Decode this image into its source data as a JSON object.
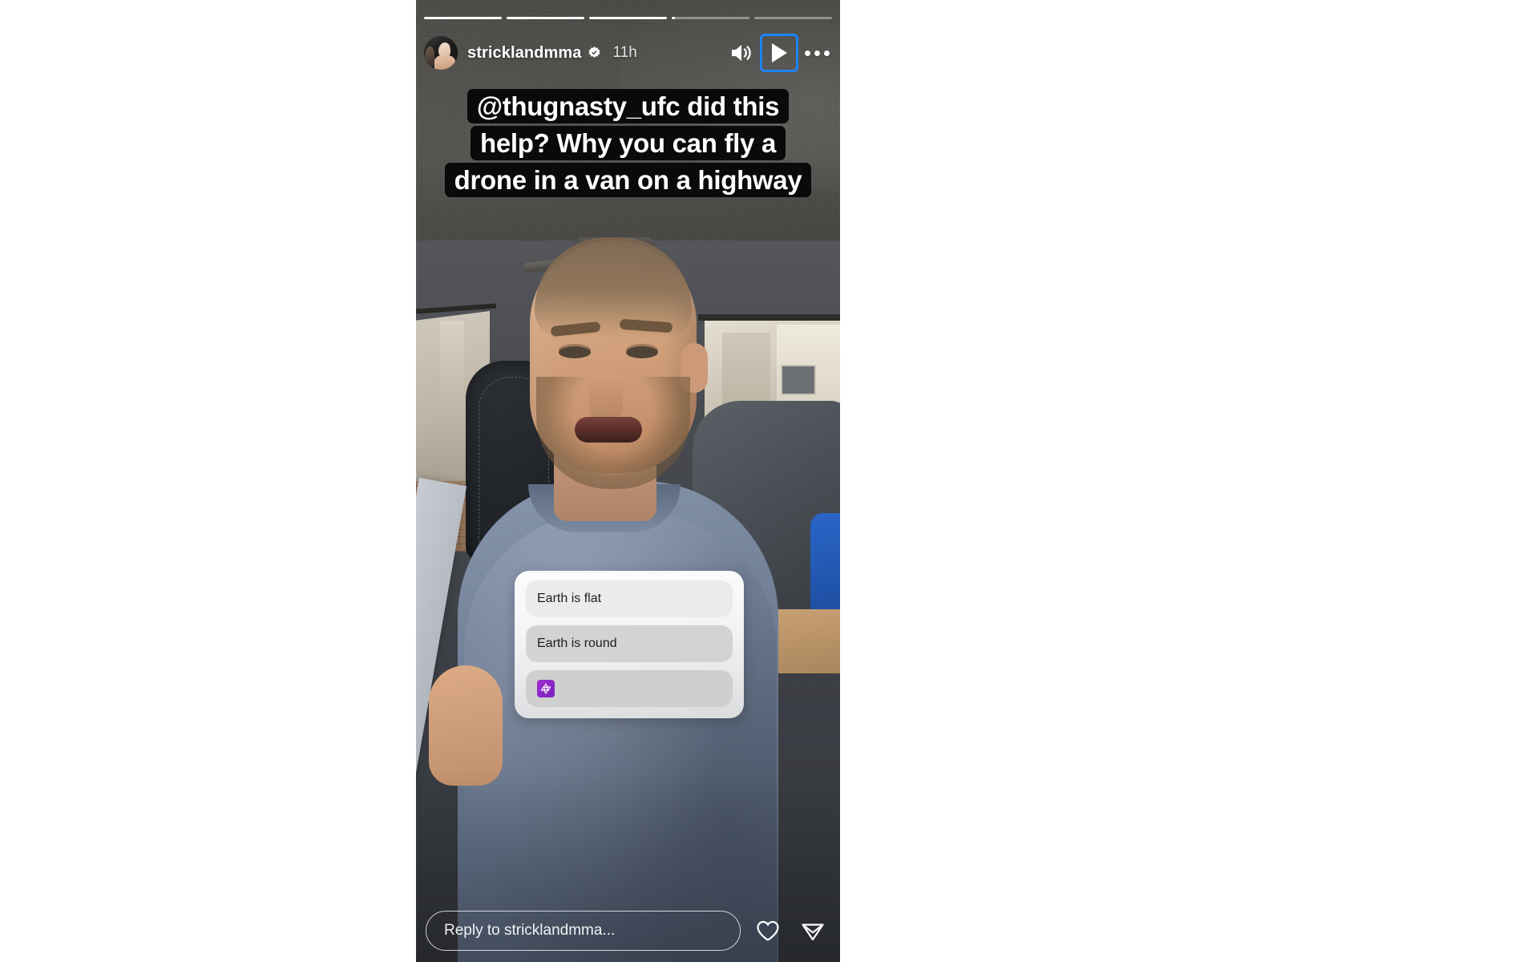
{
  "app": {
    "name": "Instagram Stories",
    "frame_background": "#4b4b4b",
    "accent_focus_color": "#1a84ff"
  },
  "progress": {
    "segment_count": 5,
    "fills_percent": [
      100,
      100,
      100,
      4,
      0
    ]
  },
  "header": {
    "avatar_alt": "stricklandmma profile photo",
    "username": "stricklandmma",
    "verified": true,
    "verified_icon": "verified-badge-icon",
    "timestamp": "11h",
    "actions": [
      {
        "icon": "volume-on-icon",
        "label": "Sound on",
        "focused": false
      },
      {
        "icon": "play-icon",
        "label": "Play",
        "focused": true
      },
      {
        "icon": "more-options-icon",
        "label": "More options",
        "focused": false
      }
    ]
  },
  "caption": {
    "lines": [
      "@thugnasty_ufc did this",
      "help? Why you can fly a",
      "drone in a van on a highway"
    ],
    "text_color": "#ffffff",
    "background_color": "#0a0a0a"
  },
  "quiz": {
    "options": [
      {
        "label": "Earth is flat",
        "emoji": null
      },
      {
        "label": "Earth is round",
        "emoji": null
      },
      {
        "label": "",
        "emoji": "star-of-david-emoji"
      }
    ]
  },
  "bottom": {
    "reply_placeholder": "Reply to stricklandmma...",
    "reply_value": "",
    "like_icon": "heart-icon",
    "share_icon": "send-paper-plane-icon"
  }
}
